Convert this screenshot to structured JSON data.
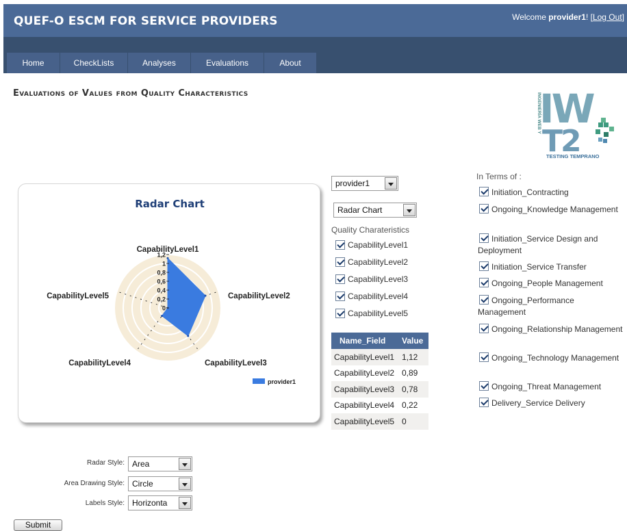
{
  "header": {
    "app_title": "QUEF-O ESCM FOR SERVICE PROVIDERS",
    "welcome_prefix": "Welcome ",
    "user": "provider1",
    "welcome_suffix": "! [",
    "logout": "Log Out",
    "bracket_close": "]"
  },
  "nav": [
    "Home",
    "CheckLists",
    "Analyses",
    "Evaluations",
    "About"
  ],
  "page_title": "Evaluations of Values from Quality Characteristics",
  "logo": {
    "text_side": "INGENIERÍA WEB Y",
    "text_bottom": "TESTING TEMPRANO",
    "letters1": "IW",
    "letters2": "T2"
  },
  "controls": {
    "provider_select": "provider1",
    "chart_select": "Radar Chart",
    "quality_label": "Quality Charateristics",
    "quality_items": [
      "CapabilityLevel1",
      "CapabilityLevel2",
      "CapabilityLevel3",
      "CapabilityLevel4",
      "CapabilityLevel5"
    ]
  },
  "terms": {
    "label": "In Terms of :",
    "items": [
      "Initiation_Contracting",
      "Ongoing_Knowledge Management",
      "Initiation_Service Design and Deployment",
      "Initiation_Service Transfer",
      "Ongoing_People Management",
      "Ongoing_Performance Management",
      "Ongoing_Relationship Management",
      "Ongoing_Technology Management",
      "Ongoing_Threat Management",
      "Delivery_Service Delivery"
    ]
  },
  "table": {
    "headers": [
      "Name_Field",
      "Value"
    ],
    "rows": [
      [
        "CapabilityLevel1",
        "1,12"
      ],
      [
        "CapabilityLevel2",
        "0,89"
      ],
      [
        "CapabilityLevel3",
        "0,78"
      ],
      [
        "CapabilityLevel4",
        "0,22"
      ],
      [
        "CapabilityLevel5",
        "0"
      ]
    ]
  },
  "form": {
    "radar_style_label": "Radar Style:",
    "radar_style_value": "Area",
    "area_drawing_label": "Area Drawing Style:",
    "area_drawing_value": "Circle",
    "labels_style_label": "Labels Style:",
    "labels_style_value": "Horizonta",
    "submit": "Submit"
  },
  "colors": {
    "header": "#4b6a97",
    "nav": "#38506f",
    "series": "#3a7be0",
    "grid_fill": "#f6ecd8"
  },
  "chart_data": {
    "type": "radar",
    "title": "Radar Chart",
    "axes": [
      "CapabilityLevel1",
      "CapabilityLevel2",
      "CapabilityLevel3",
      "CapabilityLevel4",
      "CapabilityLevel5"
    ],
    "ticks": [
      "0",
      "0,2",
      "0,4",
      "0,6",
      "0,8",
      "1",
      "1,2"
    ],
    "range": [
      0,
      1.2
    ],
    "series": [
      {
        "name": "provider1",
        "values": [
          1.12,
          0.89,
          0.78,
          0.22,
          0
        ]
      }
    ],
    "legend_position": "bottom-right"
  }
}
